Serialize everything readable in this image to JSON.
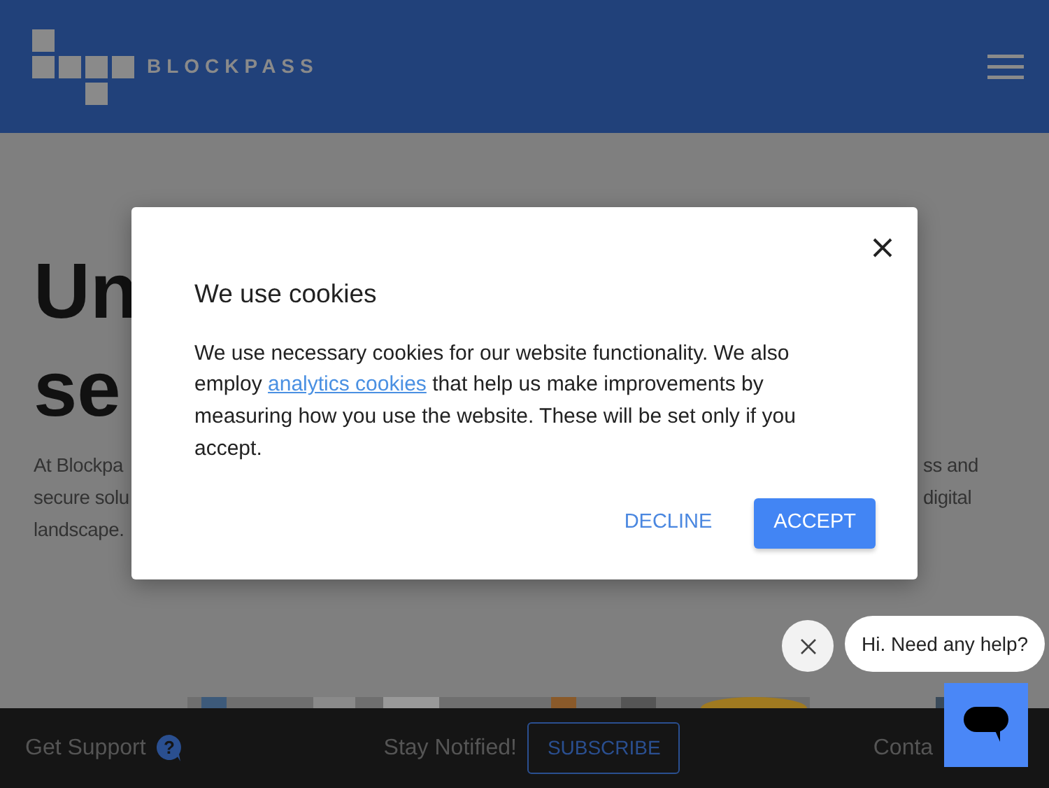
{
  "header": {
    "logo_text": "BLOCKPASS"
  },
  "hero": {
    "heading_lines": [
      "Un",
      "se"
    ],
    "paragraph_left": [
      "At Blockpa",
      "secure solu",
      "landscape."
    ],
    "paragraph_right": [
      "ss and",
      "digital"
    ]
  },
  "cookie_dialog": {
    "title": "We use cookies",
    "body_before": "We use necessary cookies for our website functionality. We also employ",
    "link": "analytics cookies",
    "body_after": "that help us make improvements by measuring how you use the website. These will be set only if you accept.",
    "buttons": [
      {
        "label": "DECLINE",
        "kind": "text"
      },
      {
        "label": "ACCEPT",
        "kind": "primary"
      }
    ]
  },
  "chat": {
    "greeting": "Hi. Need any help?"
  },
  "footer": {
    "support": "Get Support",
    "notify": "Stay Notified!",
    "subscribe": "SUBSCRIBE",
    "contact": "Conta",
    "help_mark": "?"
  }
}
